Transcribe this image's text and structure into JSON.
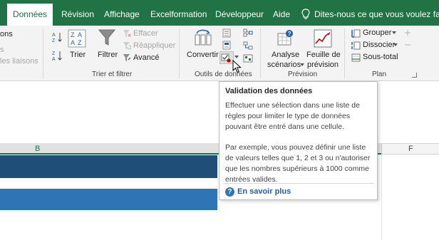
{
  "tabs": [
    {
      "label": "Données",
      "active": true
    },
    {
      "label": "Révision"
    },
    {
      "label": "Affichage"
    },
    {
      "label": "Excelformation"
    },
    {
      "label": "Développeur"
    },
    {
      "label": "Aide"
    }
  ],
  "tell_me": "Dites-nous ce que vous voulez faire",
  "ribbon": {
    "connections": {
      "item1": "ons",
      "item2": "s",
      "item3": "les liaisons"
    },
    "sort_filter": {
      "sort_label": "Trier",
      "filter_label": "Filtrer",
      "clear_label": "Effacer",
      "reapply_label": "Réappliquer",
      "advanced_label": "Avancé",
      "group_label": "Trier et filtrer"
    },
    "data_tools": {
      "convert_label": "Convertir",
      "group_label": "Outils de données"
    },
    "forecast": {
      "whatif_line1": "Analyse",
      "whatif_line2": "scénarios",
      "sheet_line1": "Feuille de",
      "sheet_line2": "prévision",
      "group_label": "Prévision"
    },
    "outline": {
      "group_btn": "Grouper",
      "ungroup_btn": "Dissocier",
      "subtotal_btn": "Sous-total",
      "group_label": "Plan"
    }
  },
  "sheet": {
    "col_b": "B",
    "col_f": "F"
  },
  "tooltip": {
    "title": "Validation des données",
    "para1": "Effectuer une sélection dans une liste de règles pour limiter le type de données pouvant être entré dans une cellule.",
    "para2": "Par exemple, vous pouvez définir une liste de valeurs telles que 1, 2 et 3 ou n'autoriser que les nombres supérieurs à 1000 comme entrées valides.",
    "help_link": "En savoir plus"
  },
  "colors": {
    "excel_green": "#217346",
    "dark_blue": "#1f4e79",
    "mid_blue": "#2e75b6"
  }
}
